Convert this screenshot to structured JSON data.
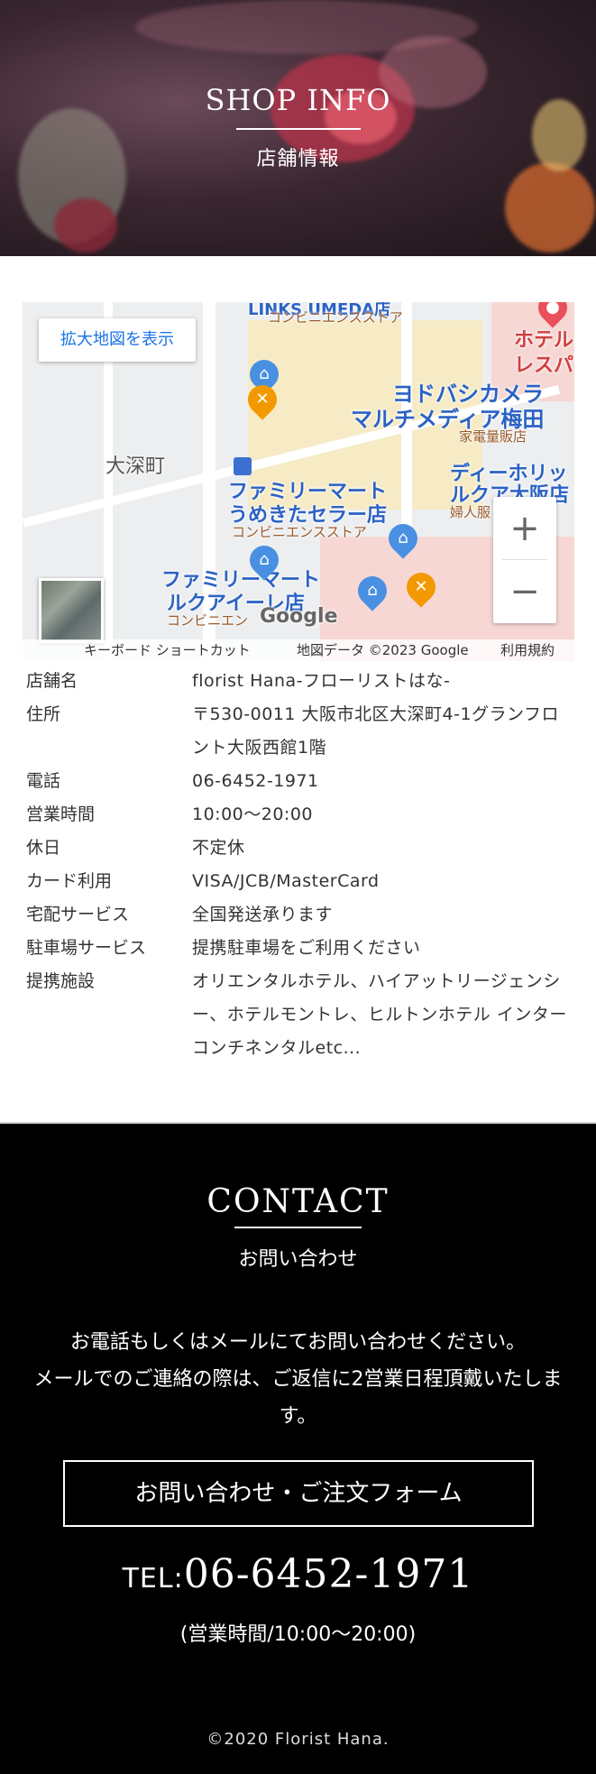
{
  "hero": {
    "title_en": "SHOP INFO",
    "title_jp": "店舗情報"
  },
  "map": {
    "enlarge_label": "拡大地図を表示",
    "zoom_in": "+",
    "zoom_out": "−",
    "google_logo": "Google",
    "labels": {
      "linx": "LINKS UMEDA店",
      "linx_sub": "コンビニエンスストア",
      "hotel": "ホテル",
      "hotel2": "レスパ",
      "yodobashi": "ヨドバシカメラ",
      "yodobashi2": "マルチメディア梅田",
      "yodobashi_sub": "家電量販店",
      "ofukacho": "大深町",
      "fm_umekita": "ファミリーマート",
      "fm_umekita2": "うめきたセラー店",
      "fm_umekita_sub": "コンビニエンスストア",
      "dior": "ディーホリッ",
      "dior2": "ルクア大阪店",
      "dior_sub": "婦人服",
      "fm_lucua": "ファミリーマート",
      "fm_lucua2": "ルクアイーレ店",
      "fm_lucua_sub": "コンビニエン"
    },
    "attribution": {
      "shortcuts": "キーボード ショートカット",
      "data": "地図データ ©2023 Google",
      "terms": "利用規約"
    }
  },
  "info": {
    "rows": [
      {
        "key": "店舗名",
        "value": "florist Hana-フローリストはな-"
      },
      {
        "key": "住所",
        "value": "〒530-0011 大阪市北区大深町4-1グランフロント大阪西館1階"
      },
      {
        "key": "電話",
        "value": "06-6452-1971"
      },
      {
        "key": "営業時間",
        "value": "10:00〜20:00"
      },
      {
        "key": "休日",
        "value": "不定休"
      },
      {
        "key": "カード利用",
        "value": "VISA/JCB/MasterCard"
      },
      {
        "key": "宅配サービス",
        "value": "全国発送承ります"
      },
      {
        "key": "駐車場サービス",
        "value": "提携駐車場をご利用ください"
      },
      {
        "key": "提携施設",
        "value": "オリエンタルホテル、ハイアットリージェンシー、ホテルモントレ、ヒルトンホテル インターコンチネンタルetc..."
      }
    ]
  },
  "contact": {
    "title_en": "CONTACT",
    "title_jp": "お問い合わせ",
    "message_1": "お電話もしくはメールにてお問い合わせください。",
    "message_2": "メールでのご連絡の際は、ご返信に2営業日程頂戴いたします。",
    "form_button": "お問い合わせ・ご注文フォーム",
    "tel_prefix": "TEL:",
    "tel_number": "06-6452-1971",
    "hours": "(営業時間/10:00〜20:00)",
    "copyright": "©2020 Florist Hana."
  }
}
